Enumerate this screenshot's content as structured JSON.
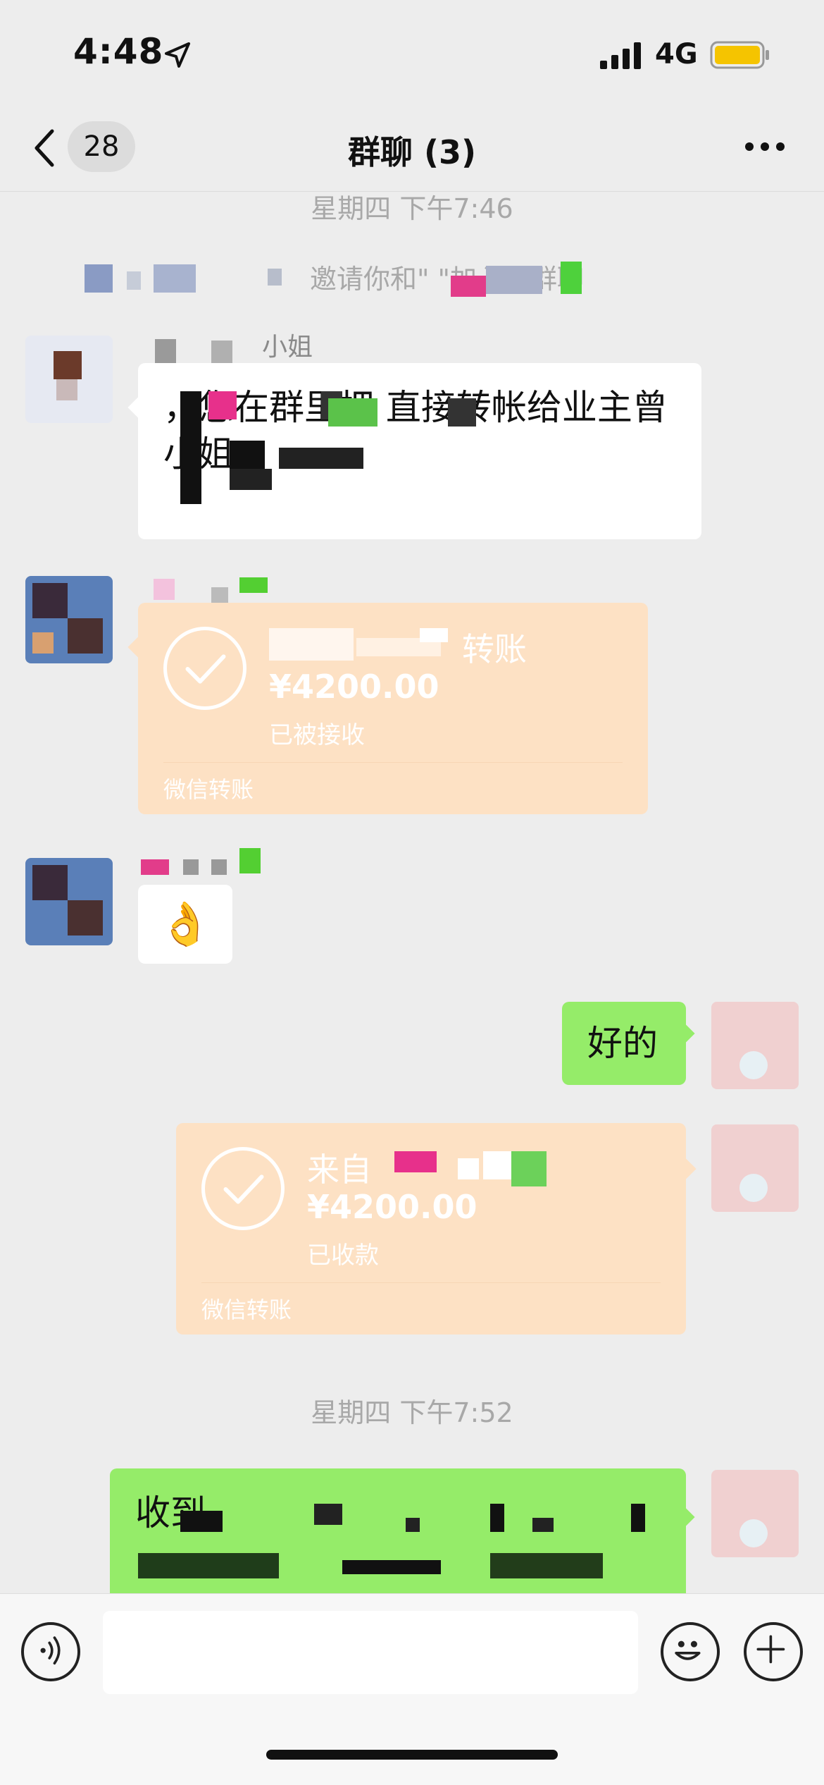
{
  "status_bar": {
    "time": "4:48",
    "network": "4G"
  },
  "nav": {
    "back_count": "28",
    "title": "群聊 (3)"
  },
  "messages": {
    "timestamp_1": "星期四 下午7:46",
    "system_notice": "邀请你和\"                 \"加入了群聊",
    "msg1": {
      "sender_suffix": "小姐",
      "text": "                    ，您在群里把             直接转帐给业主曾小姐"
    },
    "transfer1": {
      "title_suffix": "转账",
      "amount": "¥4200.00",
      "status": "已被接收",
      "footer": "微信转账"
    },
    "emoji_reply": "👌",
    "reply_ok": "好的",
    "transfer2": {
      "title_prefix": "来自",
      "amount": "¥4200.00",
      "status": "已收款",
      "footer": "微信转账"
    },
    "timestamp_2": "星期四 下午7:52",
    "msg_received": "收到"
  },
  "input": {
    "placeholder": ""
  },
  "colors": {
    "bg": "#ededed",
    "green_bubble": "#95ec69",
    "transfer": "#fde1c4",
    "timestamp": "#a8a8a8"
  }
}
